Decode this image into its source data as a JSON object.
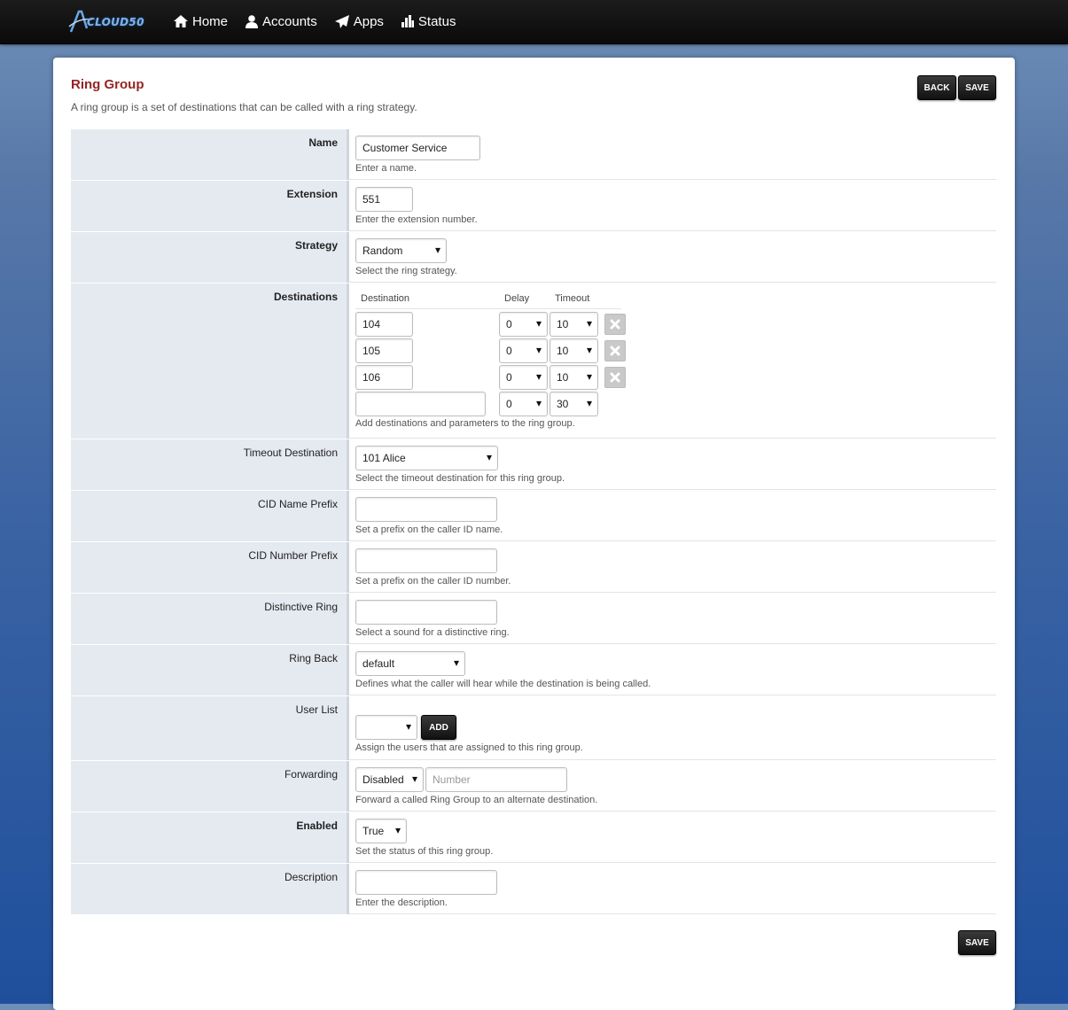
{
  "header": {
    "logo_text": "CLOUD50",
    "nav": [
      {
        "label": "Home",
        "icon": "home-icon"
      },
      {
        "label": "Accounts",
        "icon": "user-icon"
      },
      {
        "label": "Apps",
        "icon": "send-icon"
      },
      {
        "label": "Status",
        "icon": "chart-icon"
      }
    ]
  },
  "page": {
    "title": "Ring Group",
    "subtitle": "A ring group is a set of destinations that can be called with a ring strategy.",
    "back_label": "BACK",
    "save_label": "SAVE",
    "save_bottom_label": "SAVE"
  },
  "form": {
    "name": {
      "label": "Name",
      "value": "Customer Service",
      "desc": "Enter a name."
    },
    "extension": {
      "label": "Extension",
      "value": "551",
      "desc": "Enter the extension number."
    },
    "strategy": {
      "label": "Strategy",
      "value": "Random",
      "desc": "Select the ring strategy."
    },
    "destinations": {
      "label": "Destinations",
      "col_destination": "Destination",
      "col_delay": "Delay",
      "col_timeout": "Timeout",
      "rows": [
        {
          "destination": "104",
          "delay": "0",
          "timeout": "10"
        },
        {
          "destination": "105",
          "delay": "0",
          "timeout": "10"
        },
        {
          "destination": "106",
          "delay": "0",
          "timeout": "10"
        },
        {
          "destination": "",
          "delay": "0",
          "timeout": "30"
        }
      ],
      "desc": "Add destinations and parameters to the ring group."
    },
    "timeout_destination": {
      "label": "Timeout Destination",
      "value": "101 Alice",
      "desc": "Select the timeout destination for this ring group."
    },
    "cid_name_prefix": {
      "label": "CID Name Prefix",
      "value": "",
      "desc": "Set a prefix on the caller ID name."
    },
    "cid_number_prefix": {
      "label": "CID Number Prefix",
      "value": "",
      "desc": "Set a prefix on the caller ID number."
    },
    "distinctive_ring": {
      "label": "Distinctive Ring",
      "value": "",
      "desc": "Select a sound for a distinctive ring."
    },
    "ring_back": {
      "label": "Ring Back",
      "value": "default",
      "desc": "Defines what the caller will hear while the destination is being called."
    },
    "user_list": {
      "label": "User List",
      "value": "",
      "add_label": "ADD",
      "desc": "Assign the users that are assigned to this ring group."
    },
    "forwarding": {
      "label": "Forwarding",
      "value": "Disabled",
      "number_placeholder": "Number",
      "desc": "Forward a called Ring Group to an alternate destination."
    },
    "enabled": {
      "label": "Enabled",
      "value": "True",
      "desc": "Set the status of this ring group."
    },
    "description": {
      "label": "Description",
      "value": "",
      "desc": "Enter the description."
    }
  }
}
